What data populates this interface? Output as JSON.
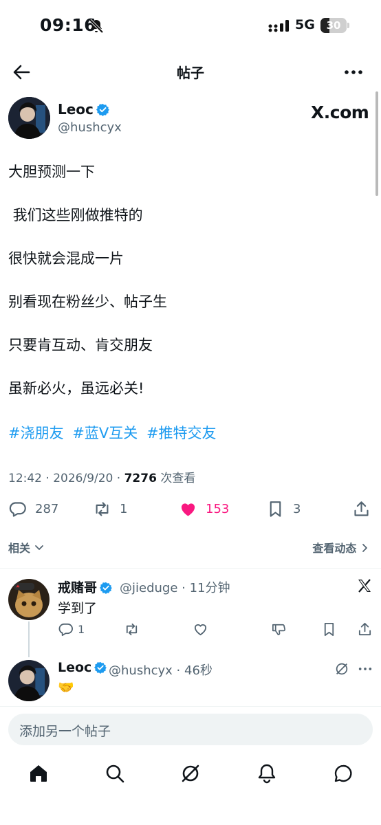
{
  "status_bar": {
    "time": "09:16",
    "network": "5G",
    "battery": "30"
  },
  "header": {
    "title": "帖子"
  },
  "post": {
    "author_name": "Leoc",
    "author_handle": "@hushcyx",
    "watermark": "X.com",
    "lines": [
      "大胆预测一下",
      " 我们这些刚做推特的",
      "很快就会混成一片",
      "别看现在粉丝少、帖子生",
      "只要肯互动、肯交朋友",
      "虽新必火，虽远必关!"
    ],
    "hashtags": [
      "#浇朋友",
      "#蓝V互关",
      "#推特交友"
    ],
    "timestamp": "12:42 · 2026/9/20 · ",
    "views_count": "7276",
    "views_label": " 次查看",
    "replies": "287",
    "reposts": "1",
    "likes": "153",
    "bookmarks": "3",
    "like_color": "#f91880"
  },
  "related": {
    "label": "相关",
    "activity_label": "查看动态"
  },
  "replies": [
    {
      "name": "戒赌哥",
      "handle": "@jieduge",
      "time": "· 11分钟",
      "text": "学到了",
      "reply_count": "1"
    },
    {
      "name": "Leoc",
      "handle": "@hushcyx",
      "time": "· 46秒",
      "text": "🤝"
    }
  ],
  "composer": {
    "placeholder": "添加另一个帖子"
  },
  "colors": {
    "accent": "#1d9bf0",
    "muted": "#536471",
    "verified": "#1d9bf0"
  }
}
